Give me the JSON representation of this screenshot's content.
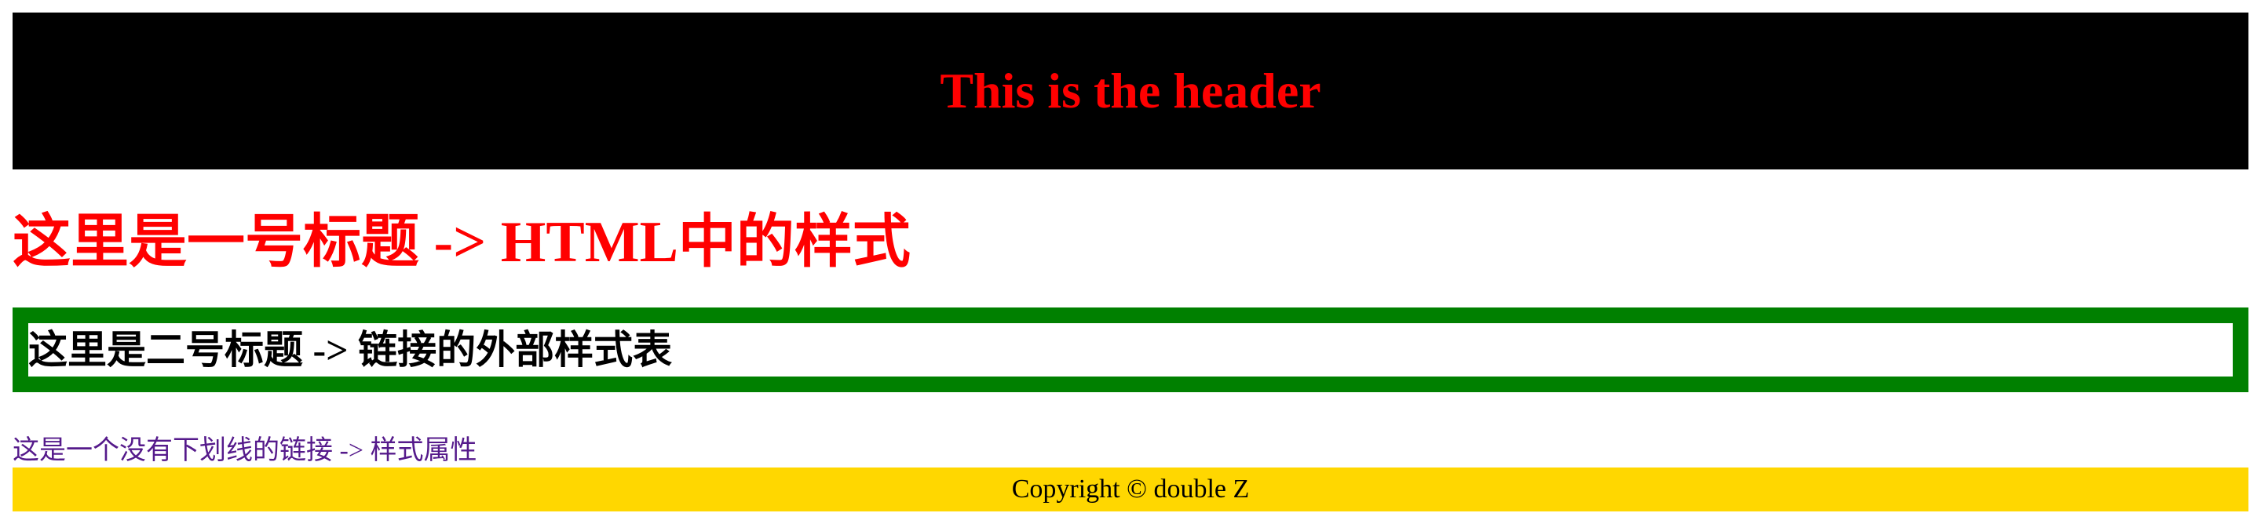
{
  "header": {
    "title": "This is the header",
    "background": "#000000",
    "title_color": "#ff0000"
  },
  "heading1": {
    "text": "这里是一号标题 -> HTML中的样式",
    "color": "#ff0000"
  },
  "heading2": {
    "text": "这里是二号标题 -> 链接的外部样式表",
    "border_color": "#008000"
  },
  "link": {
    "text": "这是一个没有下划线的链接 -> 样式属性",
    "color": "#551a8b"
  },
  "footer": {
    "text": "Copyright © double Z",
    "background": "#ffd700"
  }
}
